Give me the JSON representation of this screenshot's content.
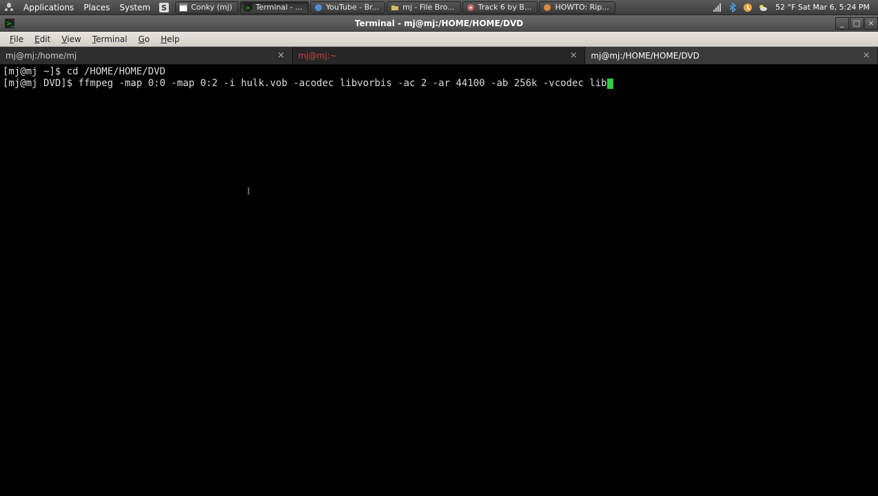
{
  "panel": {
    "menus": {
      "applications": "Applications",
      "places": "Places",
      "system": "System"
    },
    "tasks": [
      {
        "label": "Conky (mj)"
      },
      {
        "label": "Terminal - ..."
      },
      {
        "label": "YouTube - Br..."
      },
      {
        "label": "mj - File Bro..."
      },
      {
        "label": "Track 6 by B..."
      },
      {
        "label": "HOWTO: Rip..."
      }
    ],
    "clock": "52 °F Sat Mar  6,  5:24 PM"
  },
  "window": {
    "title": "Terminal - mj@mj:/HOME/HOME/DVD"
  },
  "menubar": {
    "file": "File",
    "edit": "Edit",
    "view": "View",
    "terminal": "Terminal",
    "go": "Go",
    "help": "Help"
  },
  "tabs": [
    {
      "label": "mj@mj:/home/mj"
    },
    {
      "label": "mj@mj:~"
    },
    {
      "label": "mj@mj:/HOME/HOME/DVD"
    }
  ],
  "terminal": {
    "line1": "[mj@mj ~]$ cd /HOME/HOME/DVD",
    "line2": "[mj@mj DVD]$ ffmpeg -map 0:0 -map 0:2 -i hulk.vob -acodec libvorbis -ac 2 -ar 44100 -ab 256k -vcodec lib"
  }
}
